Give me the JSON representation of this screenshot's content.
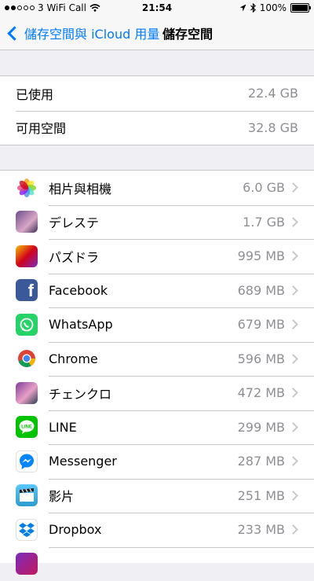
{
  "status_bar": {
    "carrier": "3 WiFi Call",
    "time": "21:54",
    "battery": "100%",
    "battery_level": 1.0
  },
  "nav": {
    "back_label": "儲存空間與 iCloud 用量",
    "title": "儲存空間"
  },
  "summary": [
    {
      "label": "已使用",
      "value": "22.4 GB"
    },
    {
      "label": "可用空間",
      "value": "32.8 GB"
    }
  ],
  "apps": [
    {
      "name": "相片與相機",
      "size": "6.0 GB",
      "icon": "photos-icon"
    },
    {
      "name": "デレステ",
      "size": "1.7 GB",
      "icon": "deresute-icon"
    },
    {
      "name": "パズドラ",
      "size": "995 MB",
      "icon": "puzzle-dragons-icon"
    },
    {
      "name": "Facebook",
      "size": "689 MB",
      "icon": "facebook-icon"
    },
    {
      "name": "WhatsApp",
      "size": "679 MB",
      "icon": "whatsapp-icon"
    },
    {
      "name": "Chrome",
      "size": "596 MB",
      "icon": "chrome-icon"
    },
    {
      "name": "チェンクロ",
      "size": "472 MB",
      "icon": "chain-chronicle-icon"
    },
    {
      "name": "LINE",
      "size": "299 MB",
      "icon": "line-icon"
    },
    {
      "name": "Messenger",
      "size": "287 MB",
      "icon": "messenger-icon"
    },
    {
      "name": "影片",
      "size": "251 MB",
      "icon": "videos-icon"
    },
    {
      "name": "Dropbox",
      "size": "233 MB",
      "icon": "dropbox-icon"
    }
  ],
  "colors": {
    "accent": "#007aff",
    "background": "#efeff4",
    "secondary_text": "#8e8e93"
  }
}
